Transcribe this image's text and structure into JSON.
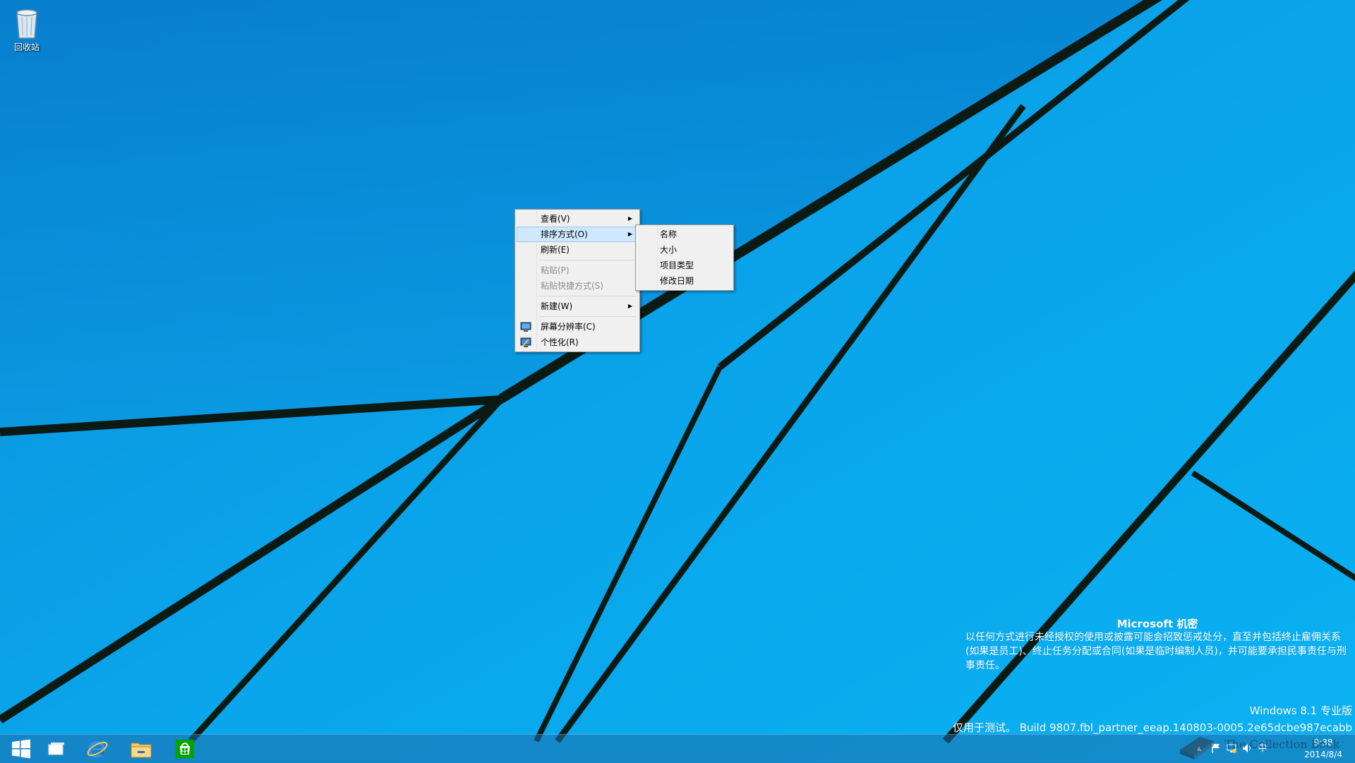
{
  "desktop": {
    "recycle_bin_label": "回收站"
  },
  "context_menu": {
    "items": [
      {
        "label": "查看(V)"
      },
      {
        "label": "排序方式(O)"
      },
      {
        "label": "刷新(E)"
      },
      {
        "label": "粘贴(P)"
      },
      {
        "label": "粘贴快捷方式(S)"
      },
      {
        "label": "新建(W)"
      },
      {
        "label": "屏幕分辨率(C)"
      },
      {
        "label": "个性化(R)"
      }
    ],
    "highlighted": "排序方式(O)"
  },
  "sort_submenu": {
    "items": [
      {
        "label": "名称"
      },
      {
        "label": "大小"
      },
      {
        "label": "项目类型"
      },
      {
        "label": "修改日期"
      }
    ]
  },
  "watermark": {
    "title": "Microsoft 机密",
    "body": "以任何方式进行未经授权的使用或披露可能会招致惩戒处分，直至并包括终止雇佣关系(如果是员工)、终止任务分配或合同(如果是临时编制人员)，并可能要承担民事责任与刑事责任。",
    "edition": "Windows 8.1 专业版",
    "build": "仅用于测试。 Build 9807.fbl_partner_eeap.140803-0005.2e65dcbe987ecabb",
    "overlay_text": "The Collection Book"
  },
  "taskbar": {
    "icons": [
      "windows-start-icon",
      "task-view-icon",
      "internet-explorer-icon",
      "file-explorer-icon",
      "store-icon"
    ],
    "tray": {
      "input_method": "中",
      "time": "9:38",
      "date": "2014/8/4"
    }
  },
  "colors": {
    "wallpaper": "#0a9ee8",
    "menu_background": "#f0f0f0",
    "menu_highlight": "#cde8ff"
  }
}
